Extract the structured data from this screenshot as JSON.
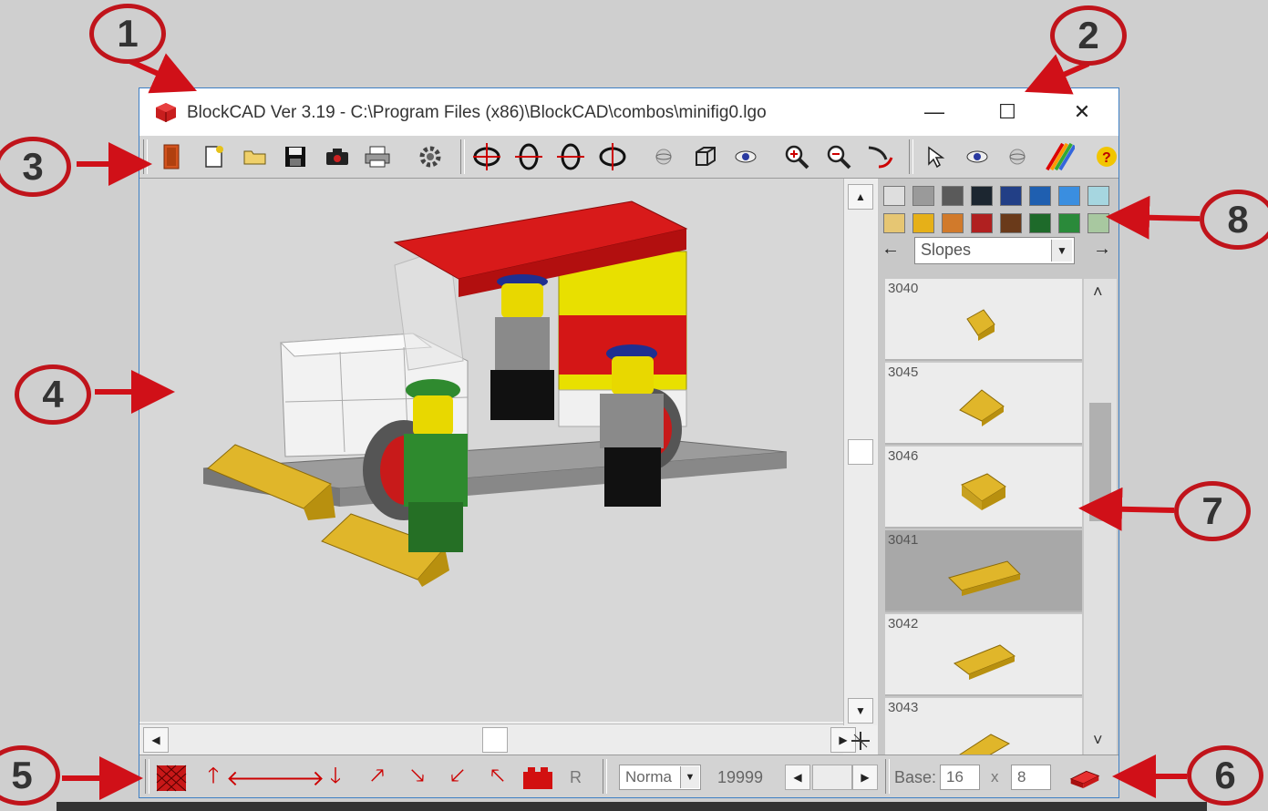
{
  "window": {
    "title": "BlockCAD Ver 3.19 - C:\\Program Files (x86)\\BlockCAD\\combos\\minifig0.lgo",
    "controls": {
      "minimize": "—",
      "maximize": "☐",
      "close": "✕"
    }
  },
  "toolbar": {
    "icons": [
      "exit-icon",
      "new-file-icon",
      "open-folder-icon",
      "save-icon",
      "camera-icon",
      "print-icon",
      "gear-icon",
      "rotate-left-icon",
      "rotate-up-icon",
      "rotate-down-icon",
      "rotate-right-icon",
      "sphere-icon",
      "box-icon",
      "eye-icon",
      "zoom-in-icon",
      "zoom-out-icon",
      "pen-icon",
      "pointer-icon",
      "eye2-icon",
      "sphere2-icon",
      "rainbow-icon",
      "help-icon"
    ]
  },
  "palette": {
    "colors": [
      "#dedede",
      "#9a9a9a",
      "#5a5a5a",
      "#1c2630",
      "#223f86",
      "#1f5fb0",
      "#3a8ee0",
      "#a6d6e0",
      "#e6c673",
      "#e6b018",
      "#d17a2b",
      "#b02020",
      "#6a3a1a",
      "#1e6a2a",
      "#2a8a3a",
      "#a8c8a0"
    ],
    "prev_arrow": "←",
    "next_arrow": "→",
    "category": "Slopes"
  },
  "parts": [
    {
      "num": "3040",
      "selected": false
    },
    {
      "num": "3045",
      "selected": false
    },
    {
      "num": "3046",
      "selected": false
    },
    {
      "num": "3041",
      "selected": true
    },
    {
      "num": "3042",
      "selected": false
    },
    {
      "num": "3043",
      "selected": false
    }
  ],
  "bottombar": {
    "r_button": "R",
    "mode": "Norma",
    "counter": "19999",
    "base_label": "Base:",
    "base_width": "16",
    "times": "x",
    "base_depth": "8"
  },
  "callouts": [
    "1",
    "2",
    "3",
    "4",
    "5",
    "6",
    "7",
    "8"
  ]
}
